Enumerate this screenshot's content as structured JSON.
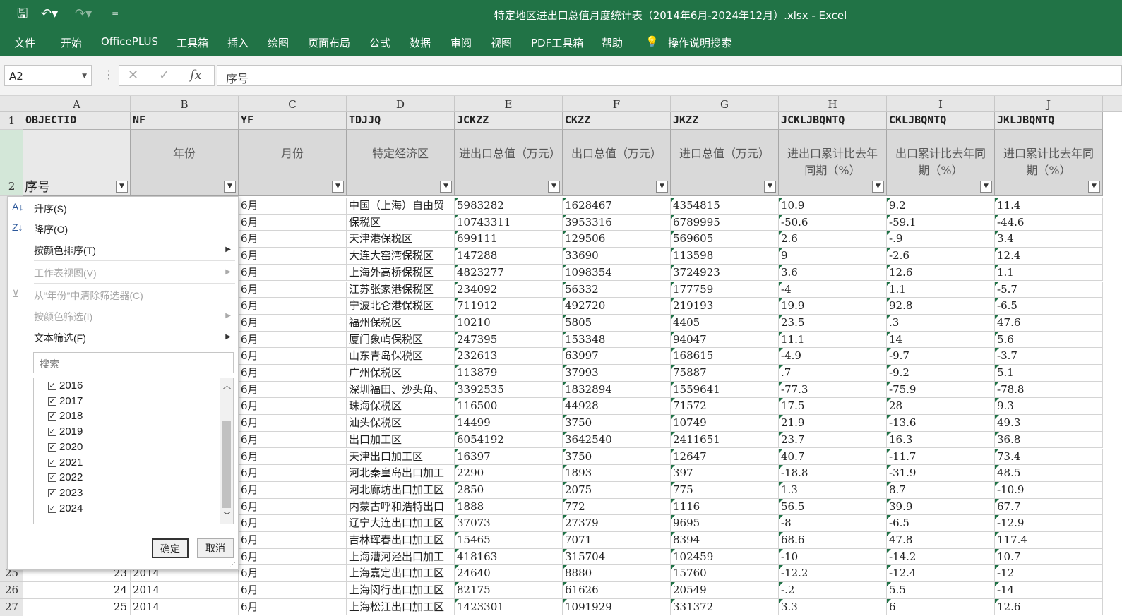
{
  "title": "特定地区进出口总值月度统计表（2014年6月-2024年12月）.xlsx  -  Excel",
  "ribbon_tabs": [
    "文件",
    "开始",
    "OfficePLUS",
    "工具箱",
    "插入",
    "绘图",
    "页面布局",
    "公式",
    "数据",
    "审阅",
    "视图",
    "PDF工具箱",
    "帮助",
    "操作说明搜索"
  ],
  "namebox": "A2",
  "formula": "序号",
  "columns": [
    "A",
    "B",
    "C",
    "D",
    "E",
    "F",
    "G",
    "H",
    "I",
    "J"
  ],
  "header_row1": [
    "OBJECTID",
    "NF",
    "YF",
    "TDJJQ",
    "JCKZZ",
    "CKZZ",
    "JKZZ",
    "JCKLJBQNTQ",
    "CKLJBQNTQ",
    "JKLJBQNTQ"
  ],
  "header_row2": [
    "序号",
    "年份",
    "月份",
    "特定经济区",
    "进出口总值（万元）",
    "出口总值（万元）",
    "进口总值（万元）",
    "进出口累计比去年同期（%）",
    "出口累计比去年同期（%）",
    "进口累计比去年同期（%）"
  ],
  "row_numbers": [
    "1",
    "2",
    "25",
    "26"
  ],
  "rows": [
    [
      "6月",
      "中国（上海）自由贸",
      "5983282",
      "1628467",
      "4354815",
      "10.9",
      "9.2",
      "11.4"
    ],
    [
      "6月",
      "保税区",
      "10743311",
      "3953316",
      "6789995",
      "-50.6",
      "-59.1",
      "-44.6"
    ],
    [
      "6月",
      "天津港保税区",
      "699111",
      "129506",
      "569605",
      "2.6",
      "-.9",
      "3.4"
    ],
    [
      "6月",
      "大连大窑湾保税区",
      "147288",
      "33690",
      "113598",
      "9",
      "-2.6",
      "12.4"
    ],
    [
      "6月",
      "上海外高桥保税区",
      "4823277",
      "1098354",
      "3724923",
      "3.6",
      "12.6",
      "1.1"
    ],
    [
      "6月",
      "江苏张家港保税区",
      "234092",
      "56332",
      "177759",
      "-4",
      "1.1",
      "-5.7"
    ],
    [
      "6月",
      "宁波北仑港保税区",
      "711912",
      "492720",
      "219193",
      "19.9",
      "92.8",
      "-6.5"
    ],
    [
      "6月",
      "福州保税区",
      "10210",
      "5805",
      "4405",
      "23.5",
      ".3",
      "47.6"
    ],
    [
      "6月",
      "厦门象屿保税区",
      "247395",
      "153348",
      "94047",
      "11.1",
      "14",
      "5.6"
    ],
    [
      "6月",
      "山东青岛保税区",
      "232613",
      "63997",
      "168615",
      "-4.9",
      "-9.7",
      "-3.7"
    ],
    [
      "6月",
      "广州保税区",
      "113879",
      "37993",
      "75887",
      ".7",
      "-9.2",
      "5.1"
    ],
    [
      "6月",
      "深圳福田、沙头角、",
      "3392535",
      "1832894",
      "1559641",
      "-77.3",
      "-75.9",
      "-78.8"
    ],
    [
      "6月",
      "珠海保税区",
      "116500",
      "44928",
      "71572",
      "17.5",
      "28",
      "9.3"
    ],
    [
      "6月",
      "汕头保税区",
      "14499",
      "3750",
      "10749",
      "21.9",
      "-13.6",
      "49.3"
    ],
    [
      "6月",
      "出口加工区",
      "6054192",
      "3642540",
      "2411651",
      "23.7",
      "16.3",
      "36.8"
    ],
    [
      "6月",
      "天津出口加工区",
      "16397",
      "3750",
      "12647",
      "40.7",
      "-11.7",
      "73.4"
    ],
    [
      "6月",
      "河北秦皇岛出口加工",
      "2290",
      "1893",
      "397",
      "-18.8",
      "-31.9",
      "48.5"
    ],
    [
      "6月",
      "河北廊坊出口加工区",
      "2850",
      "2075",
      "775",
      "1.3",
      "8.7",
      "-10.9"
    ],
    [
      "6月",
      "内蒙古呼和浩特出口",
      "1888",
      "772",
      "1116",
      "56.5",
      "39.9",
      "67.7"
    ],
    [
      "6月",
      "辽宁大连出口加工区",
      "37073",
      "27379",
      "9695",
      "-8",
      "-6.5",
      "-12.9"
    ],
    [
      "6月",
      "吉林珲春出口加工区",
      "15465",
      "7071",
      "8394",
      "68.6",
      "47.8",
      "117.4"
    ],
    [
      "6月",
      "上海漕河泾出口加工",
      "418163",
      "315704",
      "102459",
      "-10",
      "-14.2",
      "10.7"
    ],
    [
      "6月",
      "上海嘉定出口加工区",
      "24640",
      "8880",
      "15760",
      "-12.2",
      "-12.4",
      "-12"
    ],
    [
      "6月",
      "上海闵行出口加工区",
      "82175",
      "61626",
      "20549",
      "-.2",
      "5.5",
      "-14"
    ],
    [
      "6月",
      "上海松江出口加工区",
      "1423301",
      "1091929",
      "331372",
      "3.3",
      "6",
      "12.6"
    ]
  ],
  "bottom_rows": [
    {
      "rn": "25",
      "a": "23",
      "b": "2014"
    },
    {
      "rn": "26",
      "a": "24",
      "b": "2014"
    },
    {
      "rn": "27",
      "a": "25",
      "b": "2014"
    }
  ],
  "menu": {
    "sort_asc": "升序(S)",
    "sort_desc": "降序(O)",
    "sort_color": "按颜色排序(T)",
    "sheet_view": "工作表视图(V)",
    "clear_filter": "从“年份”中清除筛选器(C)",
    "filter_color": "按颜色筛选(I)",
    "text_filter": "文本筛选(F)",
    "search_placeholder": "搜索",
    "years": [
      "2016",
      "2017",
      "2018",
      "2019",
      "2020",
      "2021",
      "2022",
      "2023",
      "2024"
    ],
    "ok": "确定",
    "cancel": "取消"
  }
}
